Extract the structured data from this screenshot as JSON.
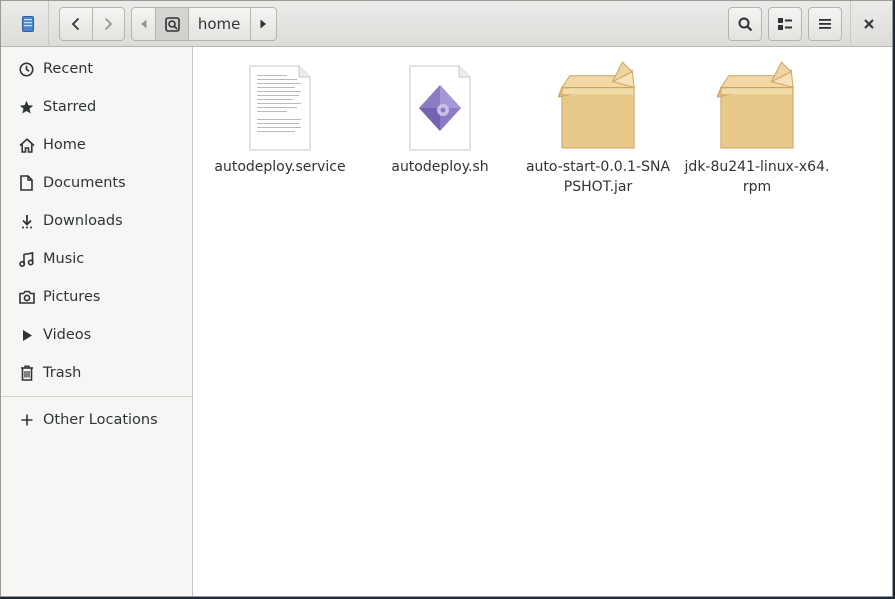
{
  "header": {
    "path_segment": "home",
    "app_icon": "files-app-icon",
    "back_icon": "chevron-left-icon",
    "forward_icon": "chevron-right-icon",
    "path_left_icon": "triangle-left-icon",
    "path_right_icon": "triangle-right-icon",
    "home_icon": "home-folder-icon",
    "search_icon": "search-icon",
    "view_icon": "list-view-icon",
    "menu_icon": "hamburger-menu-icon",
    "close_icon": "close-icon"
  },
  "sidebar": {
    "items": [
      {
        "label": "Recent",
        "icon": "clock-icon"
      },
      {
        "label": "Starred",
        "icon": "star-icon"
      },
      {
        "label": "Home",
        "icon": "home-icon"
      },
      {
        "label": "Documents",
        "icon": "document-icon"
      },
      {
        "label": "Downloads",
        "icon": "download-icon"
      },
      {
        "label": "Music",
        "icon": "music-note-icon"
      },
      {
        "label": "Pictures",
        "icon": "camera-icon"
      },
      {
        "label": "Videos",
        "icon": "play-icon"
      },
      {
        "label": "Trash",
        "icon": "trash-icon"
      }
    ],
    "other": {
      "label": "Other Locations",
      "icon": "plus-icon"
    }
  },
  "files": [
    {
      "name": "autodeploy.service",
      "icon": "text-file-icon"
    },
    {
      "name": "autodeploy.sh",
      "icon": "shell-script-icon"
    },
    {
      "name": "auto-start-0.0.1-SNAPSHOT.jar",
      "icon": "package-box-icon"
    },
    {
      "name": "jdk-8u241-linux-x64.rpm",
      "icon": "package-box-icon"
    }
  ],
  "colors": {
    "accent_script": "#8c7bc4",
    "box": "#e9c98a"
  }
}
